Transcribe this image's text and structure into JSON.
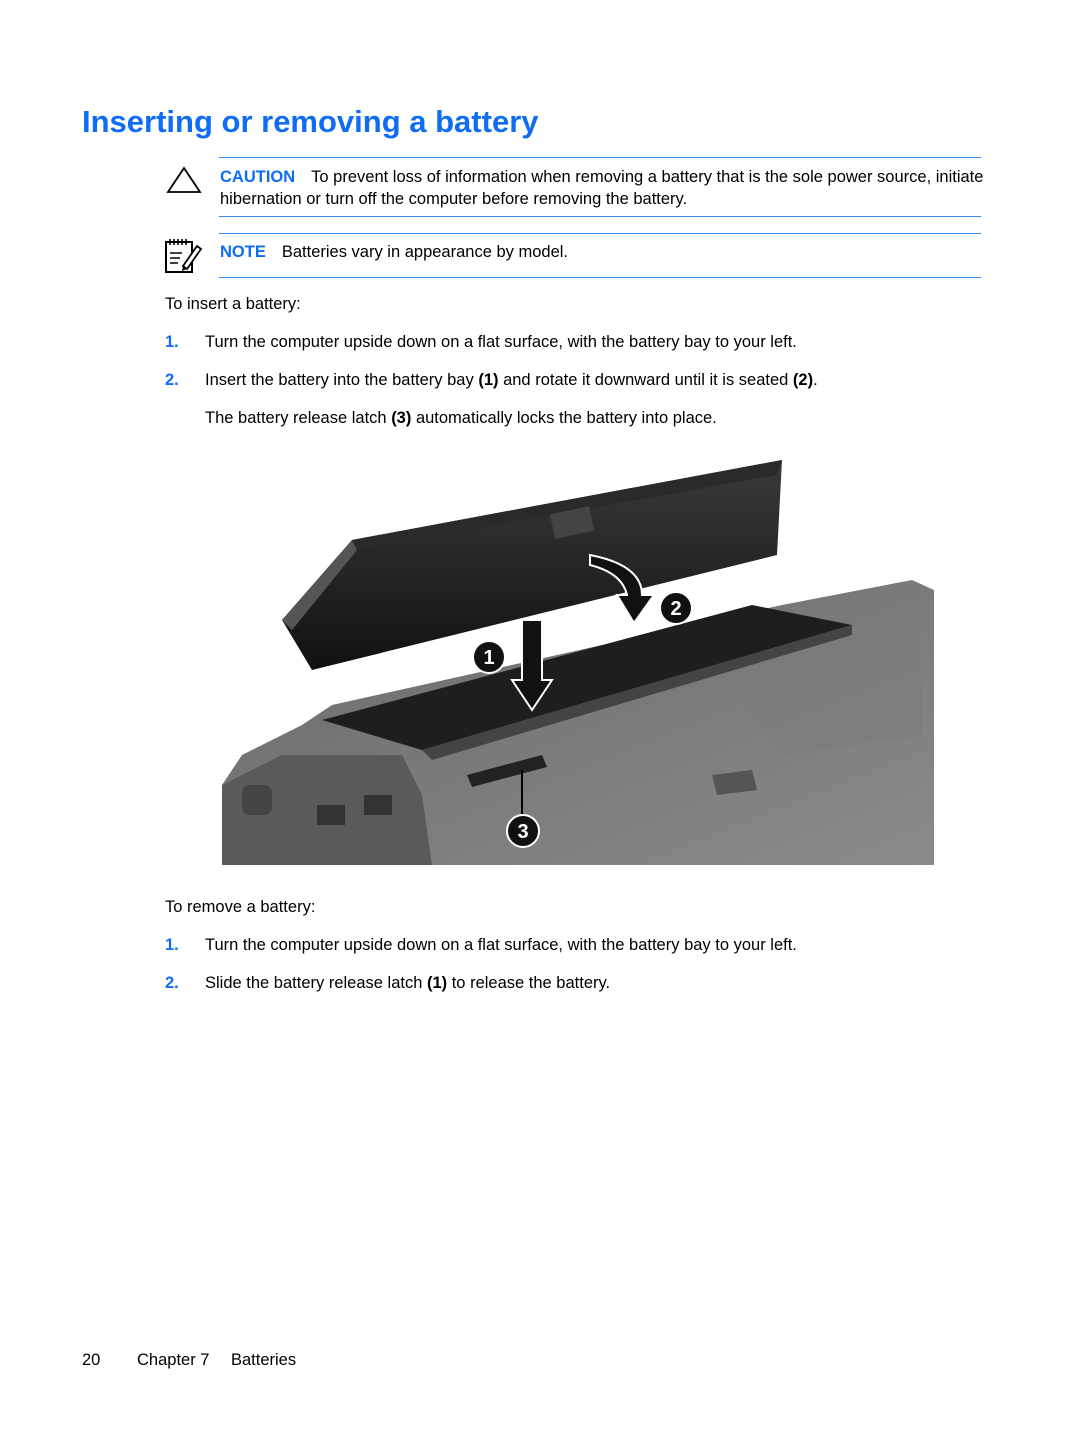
{
  "page": {
    "title": "Inserting or removing a battery",
    "caution": {
      "label": "CAUTION",
      "text": "To prevent loss of information when removing a battery that is the sole power source, initiate hibernation or turn off the computer before removing the battery."
    },
    "note": {
      "label": "NOTE",
      "text": "Batteries vary in appearance by model."
    },
    "insert": {
      "intro": "To insert a battery:",
      "steps": [
        {
          "num": "1.",
          "text": "Turn the computer upside down on a flat surface, with the battery bay to your left."
        },
        {
          "num": "2.",
          "pre": "Insert the battery into the battery bay ",
          "ref1": "(1)",
          "mid": " and rotate it downward until it is seated ",
          "ref2": "(2)",
          "post": "."
        }
      ],
      "followup": {
        "pre": "The battery release latch ",
        "ref": "(3)",
        "post": " automatically locks the battery into place."
      }
    },
    "figure": {
      "description": "Battery being inserted into the battery bay of an upside-down notebook computer",
      "callouts": [
        "1",
        "2",
        "3"
      ]
    },
    "remove": {
      "intro": "To remove a battery:",
      "steps": [
        {
          "num": "1.",
          "text": "Turn the computer upside down on a flat surface, with the battery bay to your left."
        },
        {
          "num": "2.",
          "pre": "Slide the battery release latch ",
          "ref": "(1)",
          "post": " to release the battery."
        }
      ]
    },
    "footer": {
      "page_number": "20",
      "chapter": "Chapter 7",
      "chapter_title": "Batteries"
    }
  }
}
